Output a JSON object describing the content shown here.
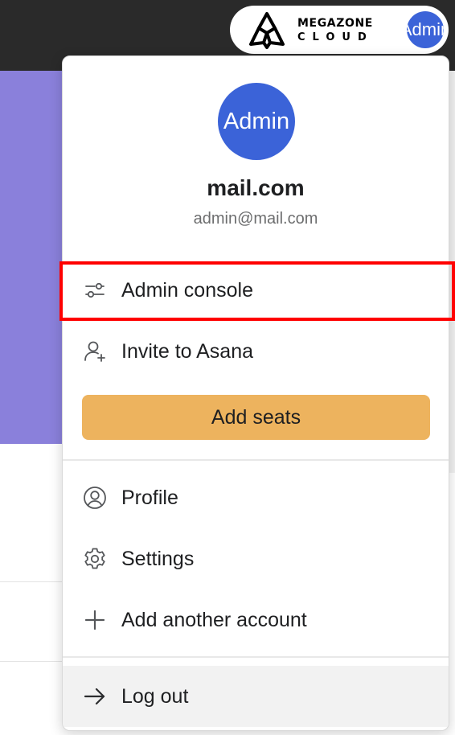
{
  "header": {
    "org_logo": {
      "line1": "MEGAZONE",
      "line2": "CLOUD",
      "icon": "megazone-triquetra-logo"
    },
    "avatar_text": "Admin"
  },
  "account": {
    "avatar_text": "Admin",
    "name": "mail.com",
    "email": "admin@mail.com"
  },
  "menu": {
    "admin_console": {
      "label": "Admin console",
      "icon": "sliders-icon"
    },
    "invite": {
      "label": "Invite to Asana",
      "icon": "add-user-icon"
    },
    "add_seats": {
      "label": "Add seats",
      "color": "#edb35e"
    },
    "profile": {
      "label": "Profile",
      "icon": "user-circle-icon"
    },
    "settings": {
      "label": "Settings",
      "icon": "gear-icon"
    },
    "add_account": {
      "label": "Add another account",
      "icon": "plus-icon"
    },
    "logout": {
      "label": "Log out",
      "icon": "arrow-right-icon"
    }
  },
  "colors": {
    "avatar": "#3b63d8",
    "highlight": "#ff0000",
    "band": "#8a80db"
  }
}
